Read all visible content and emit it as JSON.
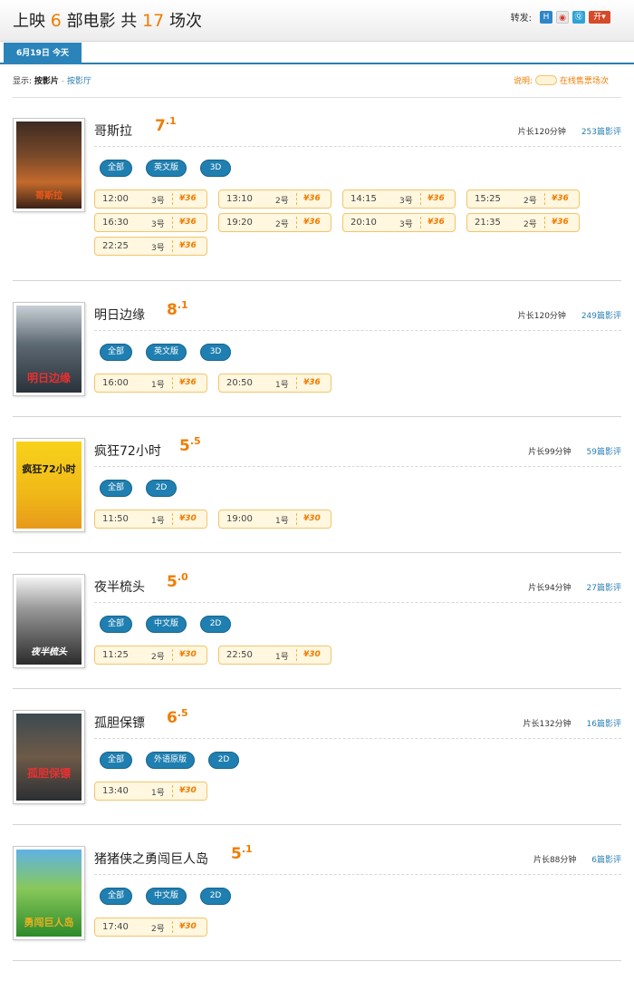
{
  "header": {
    "prefix": "上映",
    "movie_count": "6",
    "movies_word": "部电影 共",
    "session_count": "17",
    "sessions_word": "场次",
    "share_label": "转发:",
    "share_icons": [
      "renren-icon",
      "weibo-icon",
      "qzone-icon",
      "more-share-icon"
    ],
    "share_glyphs": [
      "H",
      "◉",
      "Ⓠ",
      "开▾"
    ]
  },
  "date_tab": "6月19日  今天",
  "display": {
    "label": "显示:",
    "current": "按影片",
    "separator": "-",
    "alt_link": "按影厅",
    "legend_prefix": "说明:",
    "legend_text": "在线售票场次"
  },
  "colors": {
    "accent": "#2a84b9",
    "score": "#f07c00",
    "ticket_bg": "#fff7df",
    "ticket_border": "#f3c46b"
  },
  "movies": [
    {
      "title": "哥斯拉",
      "score_int": "7",
      "score_dec": ".1",
      "duration": "片长120分钟",
      "reviews": "253篇影评",
      "poster_text": "哥斯拉",
      "filters": [
        "全部",
        "英文版",
        "3D"
      ],
      "showtimes": [
        {
          "time": "12:00",
          "hall": "3号",
          "price": "¥36"
        },
        {
          "time": "13:10",
          "hall": "2号",
          "price": "¥36"
        },
        {
          "time": "14:15",
          "hall": "3号",
          "price": "¥36"
        },
        {
          "time": "15:25",
          "hall": "2号",
          "price": "¥36"
        },
        {
          "time": "16:30",
          "hall": "3号",
          "price": "¥36"
        },
        {
          "time": "19:20",
          "hall": "2号",
          "price": "¥36"
        },
        {
          "time": "20:10",
          "hall": "3号",
          "price": "¥36"
        },
        {
          "time": "21:35",
          "hall": "2号",
          "price": "¥36"
        },
        {
          "time": "22:25",
          "hall": "3号",
          "price": "¥36"
        }
      ]
    },
    {
      "title": "明日边缘",
      "score_int": "8",
      "score_dec": ".1",
      "duration": "片长120分钟",
      "reviews": "249篇影评",
      "poster_text": "明日边缘",
      "filters": [
        "全部",
        "英文版",
        "3D"
      ],
      "showtimes": [
        {
          "time": "16:00",
          "hall": "1号",
          "price": "¥36"
        },
        {
          "time": "20:50",
          "hall": "1号",
          "price": "¥36"
        }
      ]
    },
    {
      "title": "疯狂72小时",
      "score_int": "5",
      "score_dec": ".5",
      "duration": "片长99分钟",
      "reviews": "59篇影评",
      "poster_text": "疯狂72小时",
      "filters": [
        "全部",
        "2D"
      ],
      "showtimes": [
        {
          "time": "11:50",
          "hall": "1号",
          "price": "¥30"
        },
        {
          "time": "19:00",
          "hall": "1号",
          "price": "¥30"
        }
      ]
    },
    {
      "title": "夜半梳头",
      "score_int": "5",
      "score_dec": ".0",
      "duration": "片长94分钟",
      "reviews": "27篇影评",
      "poster_text": "夜半梳头",
      "filters": [
        "全部",
        "中文版",
        "2D"
      ],
      "showtimes": [
        {
          "time": "11:25",
          "hall": "2号",
          "price": "¥30"
        },
        {
          "time": "22:50",
          "hall": "1号",
          "price": "¥30"
        }
      ]
    },
    {
      "title": "孤胆保镖",
      "score_int": "6",
      "score_dec": ".5",
      "duration": "片长132分钟",
      "reviews": "16篇影评",
      "poster_text": "孤胆保镖",
      "filters": [
        "全部",
        "外语原版",
        "2D"
      ],
      "showtimes": [
        {
          "time": "13:40",
          "hall": "1号",
          "price": "¥30"
        }
      ]
    },
    {
      "title": "猪猪侠之勇闯巨人岛",
      "score_int": "5",
      "score_dec": ".1",
      "duration": "片长88分钟",
      "reviews": "6篇影评",
      "poster_text": "勇闯巨人岛",
      "filters": [
        "全部",
        "中文版",
        "2D"
      ],
      "showtimes": [
        {
          "time": "17:40",
          "hall": "2号",
          "price": "¥30"
        }
      ]
    }
  ]
}
